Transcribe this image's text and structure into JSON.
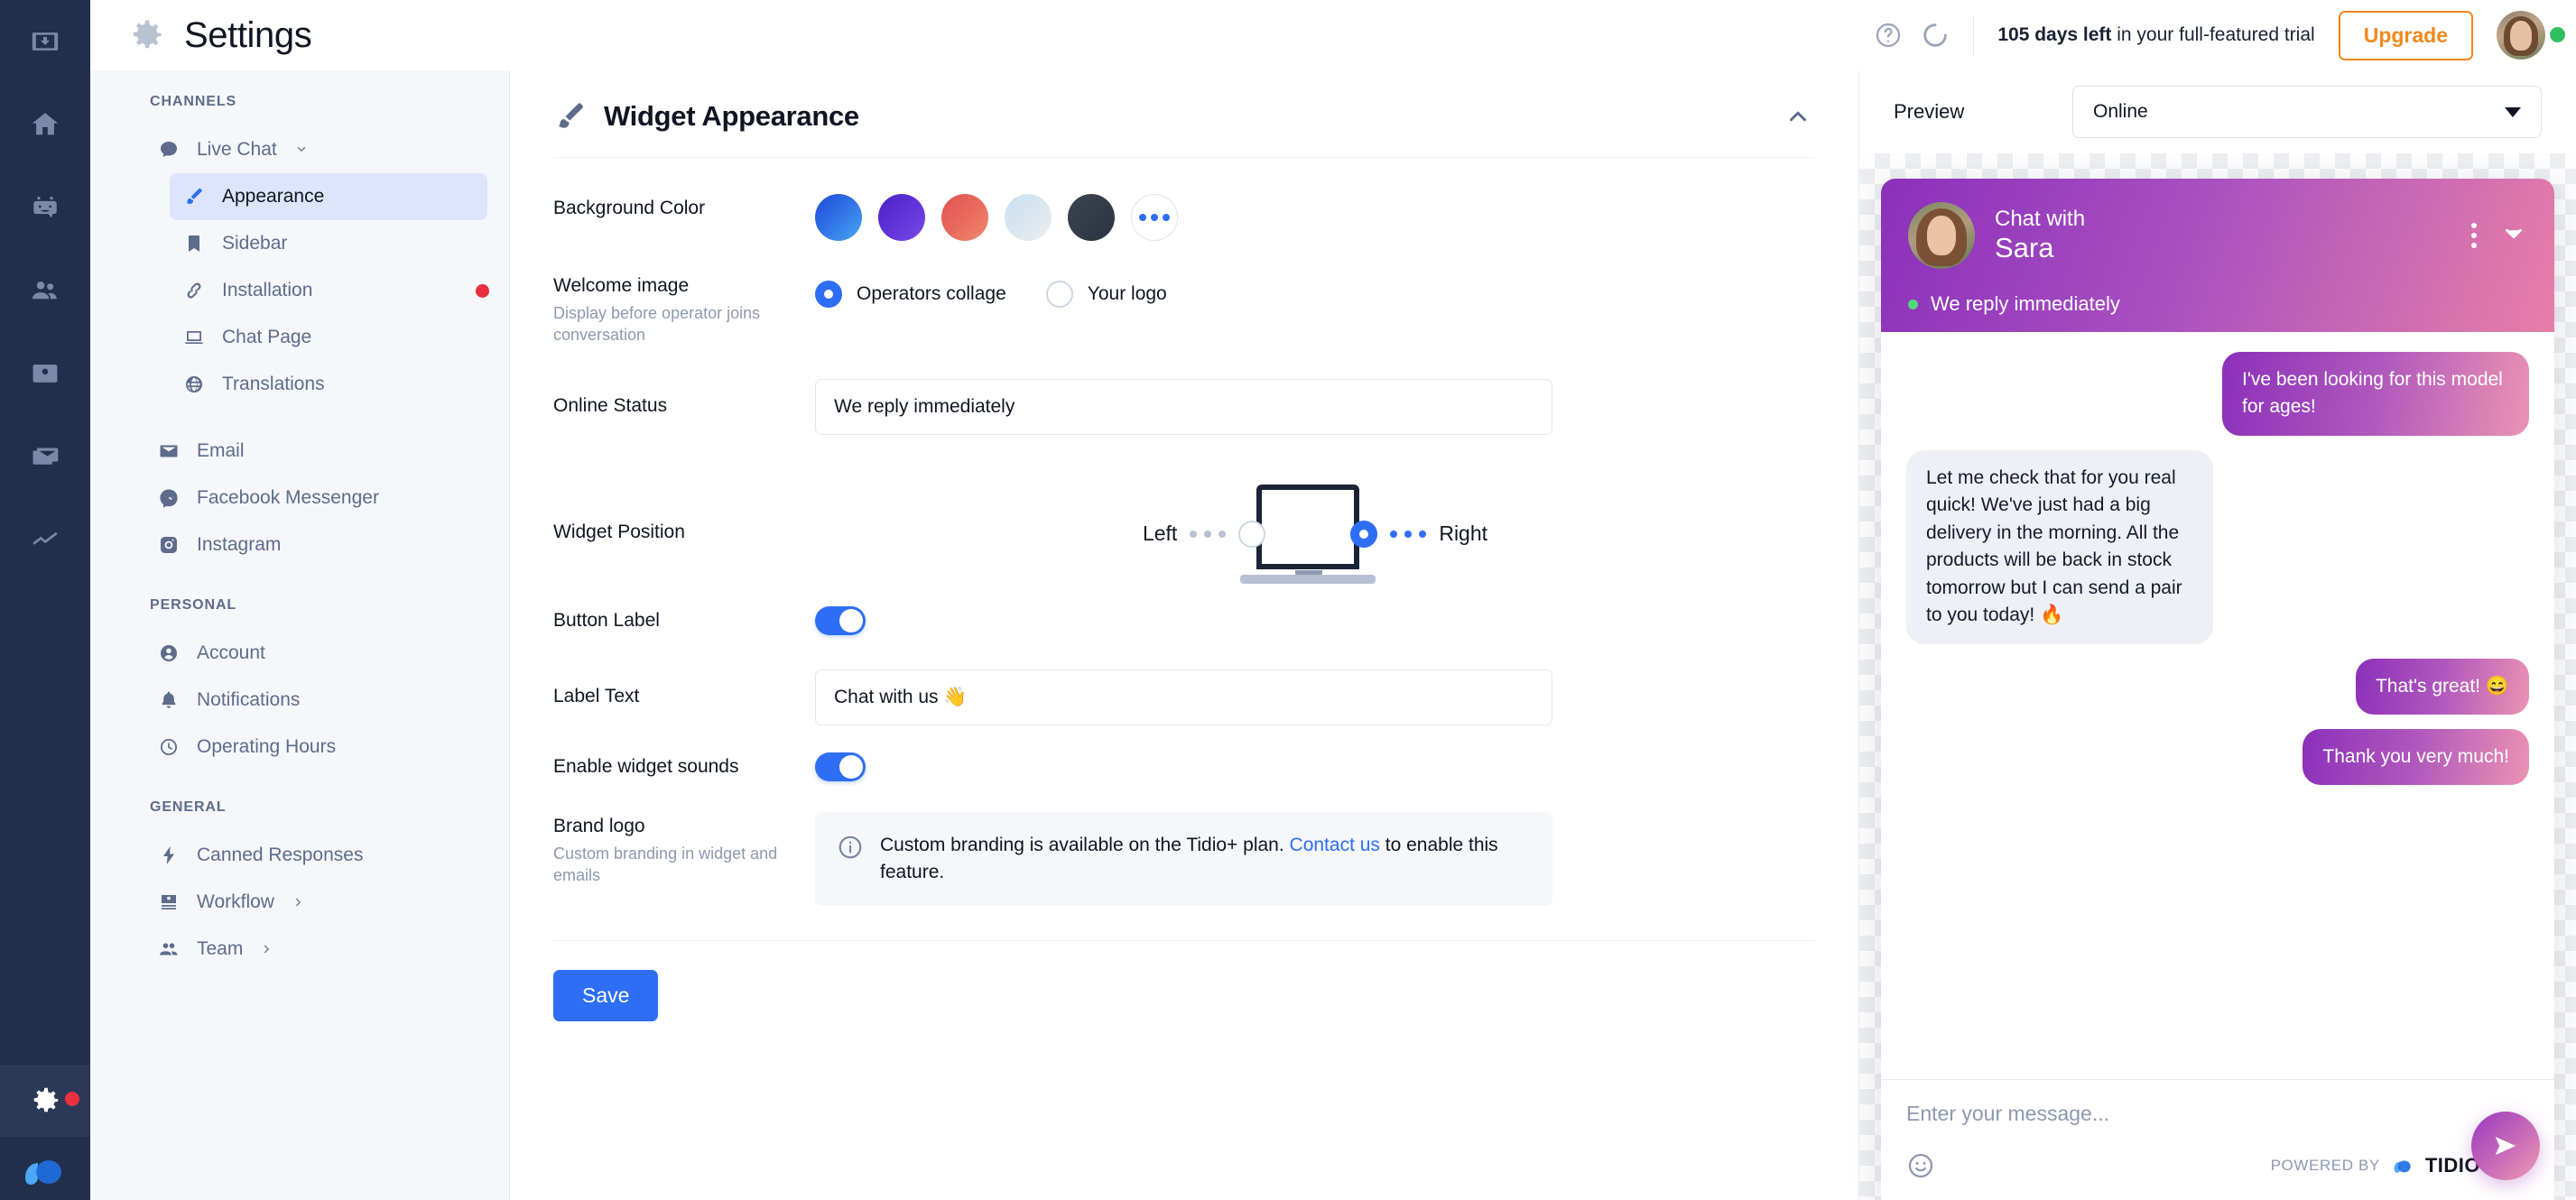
{
  "rail": {
    "icons": [
      "inbox-icon",
      "home-icon",
      "chatbot-icon",
      "visitors-icon",
      "contacts-icon",
      "mail-icon",
      "analytics-icon"
    ],
    "settings_icon": "gear-icon",
    "logo_icon": "tidio-logo-icon"
  },
  "header": {
    "title": "Settings",
    "gear_icon": "gear-icon",
    "help_icon": "help-circle-icon",
    "loading_icon": "loading-spinner-icon",
    "trial_bold": "105 days left",
    "trial_rest": " in your full-featured trial",
    "upgrade_label": "Upgrade",
    "avatar": "user-avatar",
    "accent_orange": "#f0881e"
  },
  "sidebar": {
    "sections": [
      {
        "title": "CHANNELS",
        "items": [
          {
            "label": "Live Chat",
            "icon": "chat-bubble-icon",
            "expandable": true,
            "active": false,
            "sub": false
          },
          {
            "label": "Appearance",
            "icon": "brush-icon",
            "active": true,
            "sub": true
          },
          {
            "label": "Sidebar",
            "icon": "bookmark-icon",
            "active": false,
            "sub": true
          },
          {
            "label": "Installation",
            "icon": "link-icon",
            "active": false,
            "sub": true,
            "badge": true
          },
          {
            "label": "Chat Page",
            "icon": "laptop-icon",
            "active": false,
            "sub": true
          },
          {
            "label": "Translations",
            "icon": "globe-icon",
            "active": false,
            "sub": true
          },
          {
            "label": "Email",
            "icon": "envelope-icon",
            "active": false,
            "sub": false
          },
          {
            "label": "Facebook Messenger",
            "icon": "messenger-icon",
            "active": false,
            "sub": false
          },
          {
            "label": "Instagram",
            "icon": "instagram-icon",
            "active": false,
            "sub": false
          }
        ]
      },
      {
        "title": "PERSONAL",
        "items": [
          {
            "label": "Account",
            "icon": "user-circle-icon",
            "active": false,
            "sub": false
          },
          {
            "label": "Notifications",
            "icon": "bell-icon",
            "active": false,
            "sub": false
          },
          {
            "label": "Operating Hours",
            "icon": "clock-icon",
            "active": false,
            "sub": false
          }
        ]
      },
      {
        "title": "GENERAL",
        "items": [
          {
            "label": "Canned Responses",
            "icon": "bolt-icon",
            "active": false,
            "sub": false
          },
          {
            "label": "Workflow",
            "icon": "workflow-icon",
            "active": false,
            "sub": false,
            "expandable": true
          },
          {
            "label": "Team",
            "icon": "team-icon",
            "active": false,
            "sub": false,
            "expandable": true
          }
        ]
      }
    ]
  },
  "card": {
    "title": "Widget Appearance",
    "brush_icon": "brush-icon",
    "collapse_icon": "chevron-up-icon",
    "fields": {
      "background_color": {
        "label": "Background Color",
        "swatches": [
          "#2563eb",
          "#5b2fd6",
          "#e8675f",
          "#d5e4f2",
          "#3a4150"
        ],
        "more_icon": "more-dots-icon"
      },
      "welcome_image": {
        "label": "Welcome image",
        "sub": "Display before operator joins conversation",
        "options": [
          {
            "label": "Operators collage",
            "selected": true
          },
          {
            "label": "Your logo",
            "selected": false
          }
        ]
      },
      "online_status": {
        "label": "Online Status",
        "value": "We reply immediately"
      },
      "widget_position": {
        "label": "Widget Position",
        "left_label": "Left",
        "right_label": "Right",
        "selected": "Right",
        "graphic": "laptop-icon"
      },
      "button_label": {
        "label": "Button Label",
        "enabled": true
      },
      "label_text": {
        "label": "Label Text",
        "value": "Chat with us 👋"
      },
      "widget_sounds": {
        "label": "Enable widget sounds",
        "enabled": true
      },
      "brand_logo": {
        "label": "Brand logo",
        "sub": "Custom branding in widget and emails",
        "info_icon": "info-circle-icon",
        "info_text_before": "Custom branding is available on the Tidio+ plan. ",
        "info_link": "Contact us",
        "info_text_after": " to enable this feature."
      }
    },
    "save_label": "Save"
  },
  "preview": {
    "label": "Preview",
    "state_value": "Online",
    "caret_icon": "chevron-down-icon",
    "widget": {
      "avatar": "operator-avatar",
      "title_line1": "Chat with",
      "title_line2": "Sara",
      "kebab_icon": "more-vertical-icon",
      "minimize_icon": "chevron-down-icon",
      "status_text": "We reply immediately",
      "status_color": "#52d97a",
      "messages": [
        {
          "direction": "out",
          "text": "I've been looking for this model for ages!"
        },
        {
          "direction": "in",
          "text": "Let me check that for you real quick! We've just had a big delivery in the morning. All the products will be back in stock tomorrow but I can send a pair to you today! 🔥"
        },
        {
          "direction": "out",
          "text": "That's great! 😄"
        },
        {
          "direction": "out",
          "text": "Thank you very much!"
        }
      ],
      "input_placeholder": "Enter your message...",
      "emoji_icon": "smiley-icon",
      "powered_by": "POWERED BY",
      "brand": "TIDIO",
      "send_icon": "send-icon"
    }
  }
}
